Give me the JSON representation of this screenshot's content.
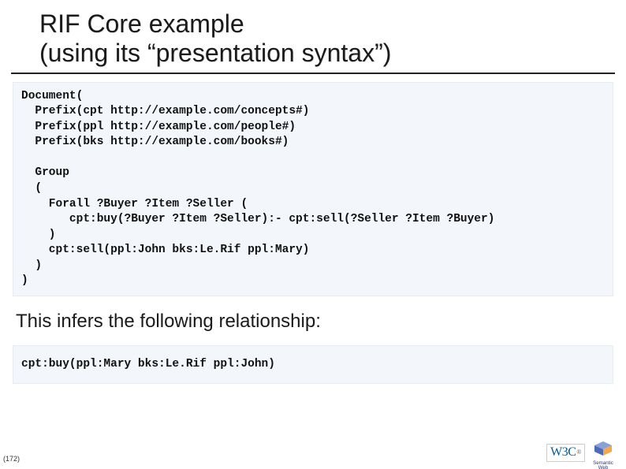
{
  "title_line1": "RIF Core example",
  "title_line2": "(using its “presentation syntax”)",
  "code_block_1": "Document(\n  Prefix(cpt http://example.com/concepts#)\n  Prefix(ppl http://example.com/people#)\n  Prefix(bks http://example.com/books#)\n\n  Group\n  (\n    Forall ?Buyer ?Item ?Seller (\n       cpt:buy(?Buyer ?Item ?Seller):- cpt:sell(?Seller ?Item ?Buyer)\n    )\n    cpt:sell(ppl:John bks:Le.Rif ppl:Mary)\n  )\n)",
  "body_text": "This infers the following relationship:",
  "code_block_2": "cpt:buy(ppl:Mary bks:Le.Rif ppl:John)",
  "slide_number": "(172)",
  "logos": {
    "w3c": "W3C",
    "semantic_web": "Semantic Web"
  }
}
